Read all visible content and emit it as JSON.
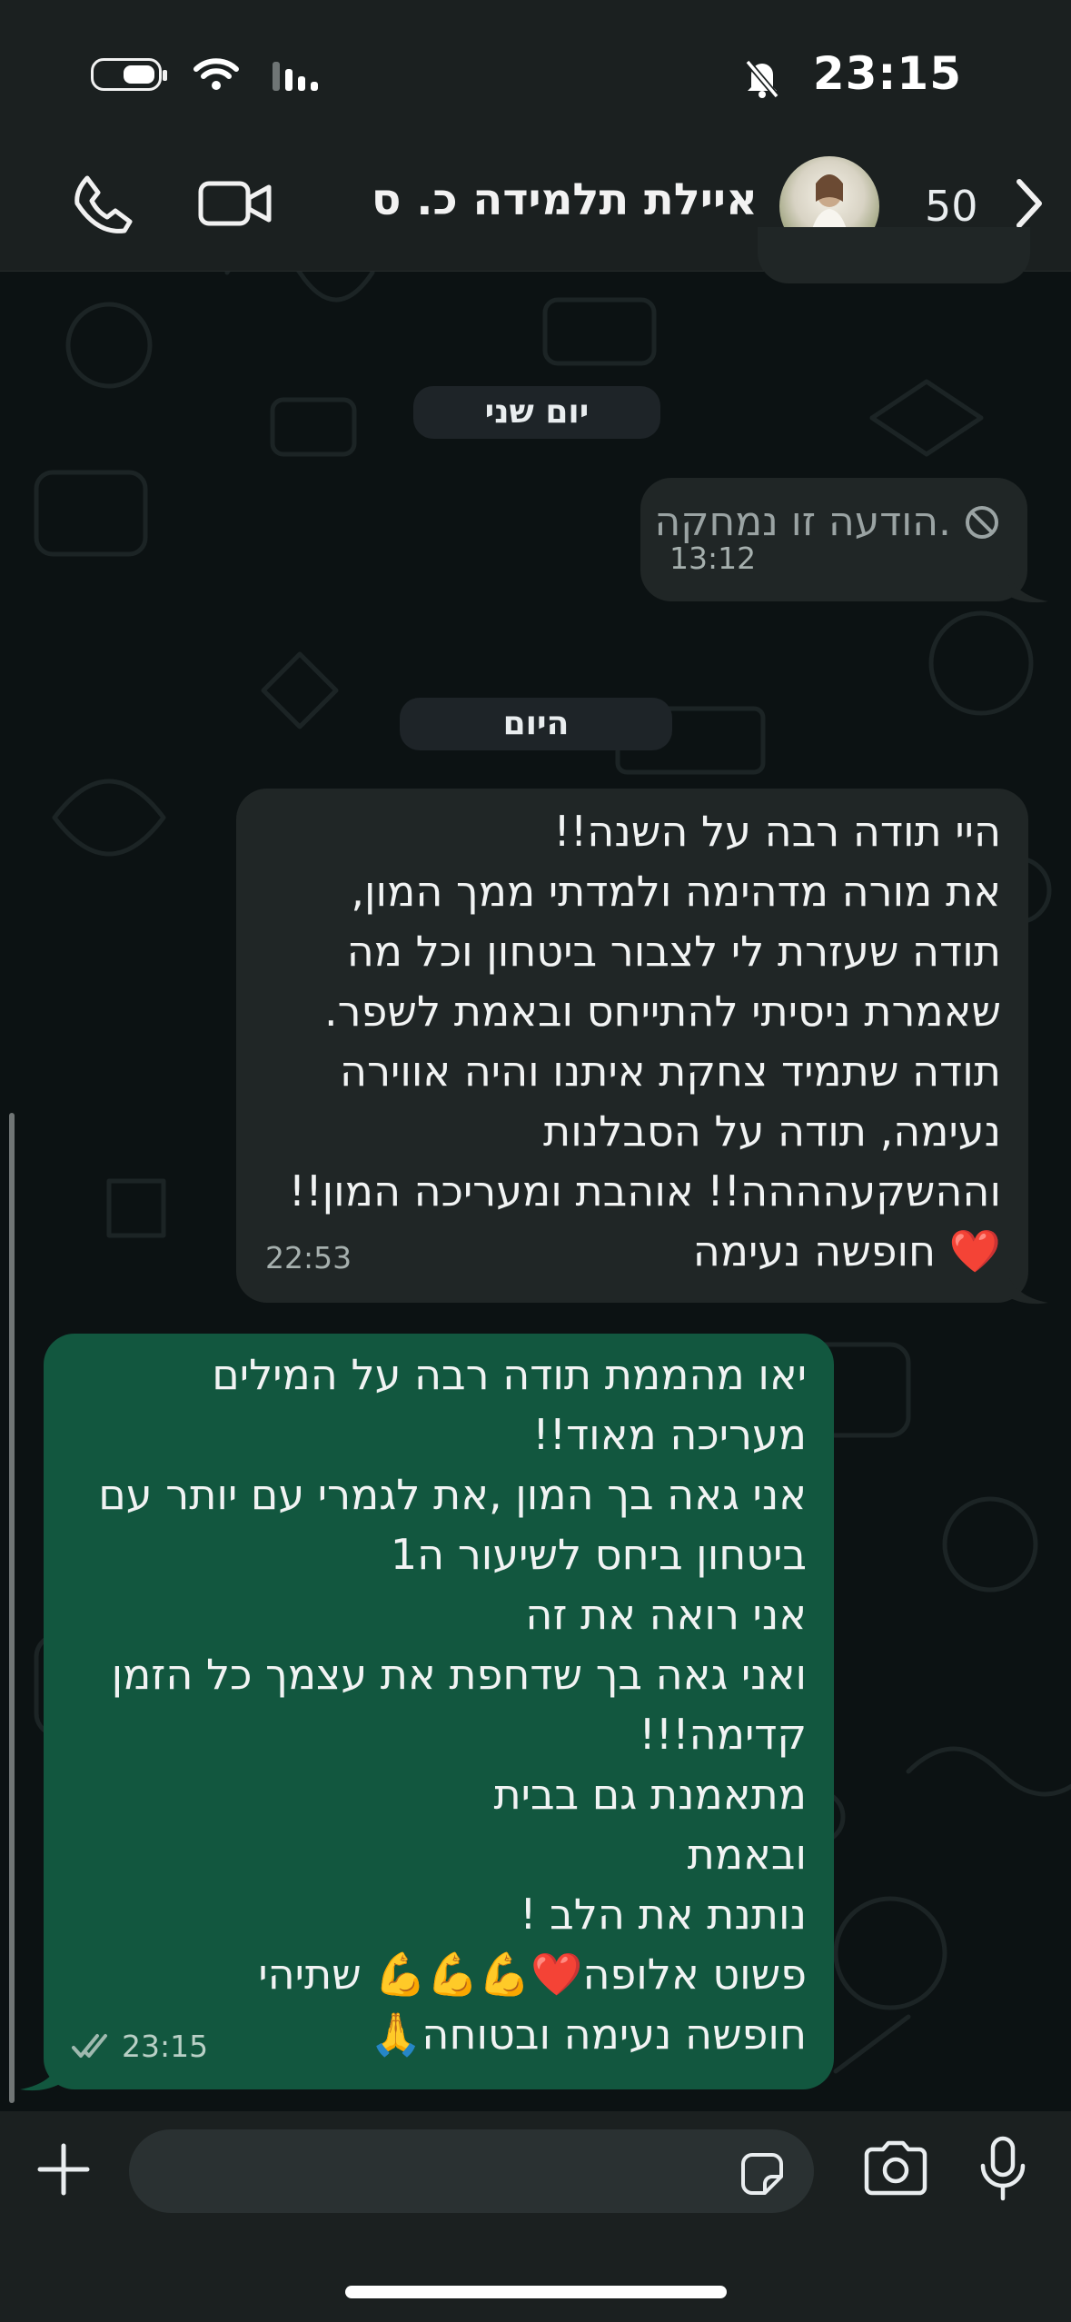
{
  "status_bar": {
    "time": "23:15",
    "icons": [
      "battery-icon",
      "wifi-icon",
      "signal-icon",
      "bell-muted-icon"
    ]
  },
  "header": {
    "contact_name": "איילת תלמידה כ. ס",
    "unread_count": "50",
    "icons": [
      "phone-icon",
      "video-icon",
      "chevron-right-icon",
      "avatar"
    ]
  },
  "chat": {
    "dates": {
      "yesterday": "יום שני",
      "today": "היום"
    },
    "messages": [
      {
        "direction": "in",
        "deleted": true,
        "text": "הודעה זו נמחקה.",
        "time": "13:12"
      },
      {
        "direction": "in",
        "text": "היי תודה רבה על השנה!!\nאת מורה מדהימה ולמדתי ממך המון,\nתודה שעזרת לי לצבור ביטחון וכל מה\nשאמרת ניסיתי להתייחס ובאמת לשפר.\nתודה שתמיד צחקת איתנו והיה אווירה\nנעימה, תודה על הסבלנות\nוההשקעהההה!! אוהבת ומעריכה המון!!\n❤️ חופשה נעימה",
        "time": "22:53"
      },
      {
        "direction": "out",
        "text": "יאו מהממת תודה רבה על המילים\nמעריכה מאוד!!\nאני גאה בך המון ,את לגמרי עם יותר עם\nביטחון ביחס לשיעור ה1\nאני רואה את זה\nואני גאה בך שדחפת את עצמך כל הזמן\nקדימה!!!\n מתאמנת גם בבית\nובאמת\nנותנת את הלב !\nפשוט אלופה❤️💪💪💪 שתיהי\nחופשה נעימה ובטוחה🙏",
        "time": "23:15",
        "status": "read"
      }
    ]
  },
  "input_bar": {
    "icons": [
      "plus-icon",
      "sticker-icon",
      "camera-icon",
      "mic-icon"
    ]
  },
  "colors": {
    "outgoing_bubble": "#12573f",
    "incoming_bubble": "#202626",
    "bar_background": "#1b2020"
  }
}
